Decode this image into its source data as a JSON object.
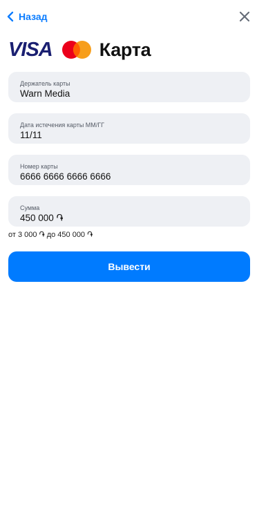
{
  "header": {
    "back_label": "Назад"
  },
  "brand": {
    "visa_label": "VISA",
    "title": "Карта"
  },
  "form": {
    "holder": {
      "label": "Держатель карты",
      "value": "Warn Media"
    },
    "expiry": {
      "label": "Дата истечения карты ММ/ГГ",
      "value": "11/11"
    },
    "number": {
      "label": "Номер карты",
      "value": "6666 6666 6666 6666"
    },
    "amount": {
      "label": "Сумма",
      "value": "450 000 ֏"
    },
    "limits_hint": "от 3 000 ֏ до 450 000 ֏"
  },
  "actions": {
    "submit_label": "Вывести"
  },
  "colors": {
    "accent": "#007bff",
    "field_bg": "#eef0f4",
    "visa_blue": "#1a1f71",
    "mc_red": "#eb001b",
    "mc_orange": "#f79e1b"
  }
}
